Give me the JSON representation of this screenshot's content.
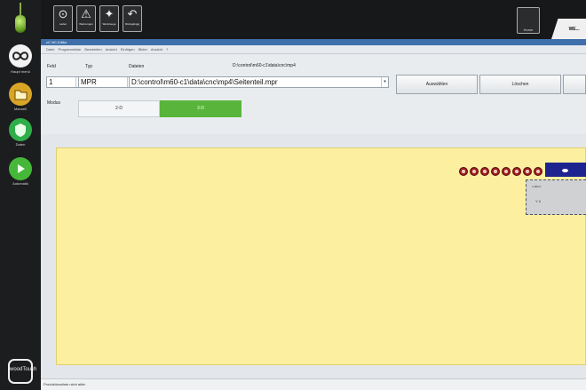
{
  "sidebar": {
    "items": [
      {
        "label": "Haupt menü",
        "icon": "infinity-icon",
        "color": "#f2f2f2"
      },
      {
        "label": "Manuell",
        "icon": "folder-icon",
        "color": "#d9a526"
      },
      {
        "label": "Daten",
        "icon": "shield-icon",
        "color": "#2fae4a"
      },
      {
        "label": "Automatik",
        "icon": "play-icon",
        "color": "#45b83a"
      }
    ],
    "brand": "woodTouch"
  },
  "toolbar": {
    "tools": [
      {
        "label": "Laden",
        "icon": "download-icon"
      },
      {
        "label": "Warnungen",
        "icon": "warning-icon"
      },
      {
        "label": "Werkzeuge",
        "icon": "tool-icon"
      },
      {
        "label": "Rückgängig",
        "icon": "undo-icon"
      }
    ],
    "home_label": "Home",
    "tab_label": "WE..."
  },
  "dialog": {
    "title": "cC NC-Editor",
    "menu": "Datei Programmliste Bearbeiten Ansicht Einfügen Bilder Ansicht ?"
  },
  "form": {
    "feld_label": "Feld",
    "feld_value": "1",
    "typ_label": "Typ",
    "typ_value": "MPR",
    "dateien_label": "Dateien",
    "path_caption": "D:\\control\\m60-c1\\data\\cnc\\mp4",
    "file_value": "D:\\control\\m60-c1\\data\\cnc\\mp4\\Seitenteil.mpr",
    "btn_select": "Auswählen",
    "btn_delete": "Löschen",
    "mode_label": "Modus",
    "seg_2d": "2-D",
    "seg_3d": "3-D"
  },
  "workpiece": {
    "drill_count": 8,
    "fill": "#fcf0a0",
    "drill_color": "#a02020",
    "panel_text_1": "X 800.0",
    "panel_text_2": "Y 0"
  },
  "status": "Produktionsliste nicht aktiv"
}
